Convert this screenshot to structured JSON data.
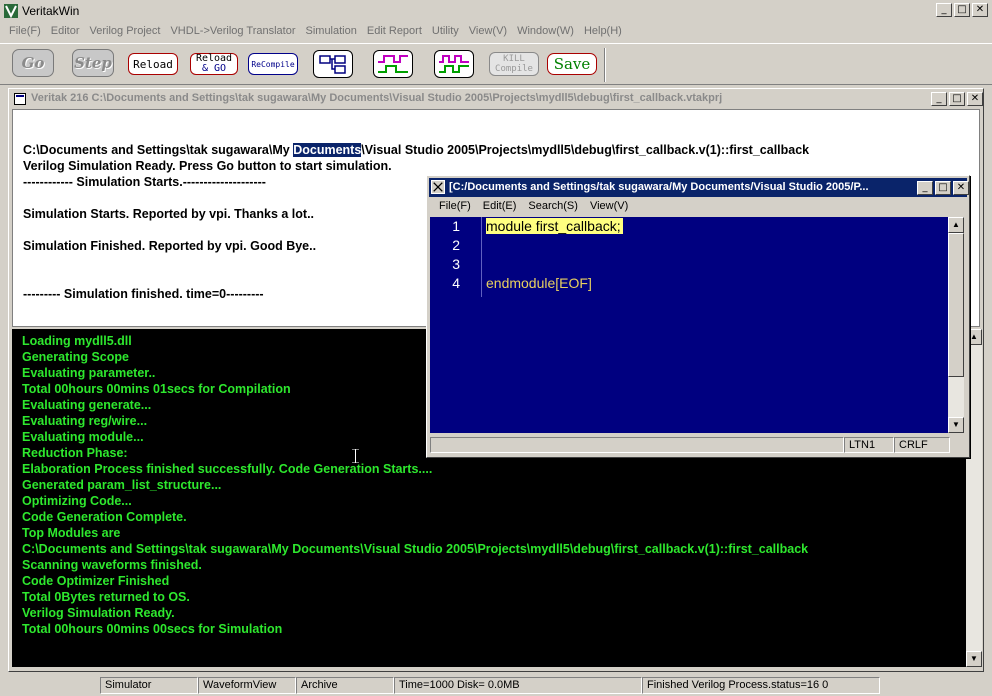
{
  "app": {
    "title": "VeritakWin",
    "window_buttons": {
      "minimize": "_",
      "maximize": "□",
      "close": "✕"
    }
  },
  "menubar": [
    "File(F)",
    "Editor",
    "Verilog Project",
    "VHDL->Verilog Translator",
    "Simulation",
    "Edit Report",
    "Utility",
    "View(V)",
    "Window(W)",
    "Help(H)"
  ],
  "toolbar": {
    "go": "Go",
    "step": "Step",
    "reload": "Reload",
    "reload_go_1": "Reload",
    "reload_go_2": "& GO",
    "recompile": "ReCompile",
    "kill_1": "KILL",
    "kill_2": "Compile",
    "save": "Save"
  },
  "project_window": {
    "title": "Veritak 216 C:\\Documents and Settings\\tak sugawara\\My Documents\\Visual Studio 2005\\Projects\\mydll5\\debug\\first_callback.vtakprj"
  },
  "log": {
    "path_pre": "C:\\Documents and Settings\\tak sugawara\\My ",
    "path_sel": "Documents",
    "path_post": "\\Visual Studio 2005\\Projects\\mydll5\\debug\\first_callback.v(1)::first_callback",
    "lines": [
      "Verilog Simulation Ready. Press Go button to start simulation.",
      "------------ Simulation Starts.--------------------",
      "Simulation Starts. Reported by vpi. Thanks a lot..",
      "Simulation Finished. Reported by vpi. Good Bye..",
      "--------- Simulation finished. time=0---------"
    ]
  },
  "console": [
    "Loading mydll5.dll",
    " Generating Scope",
    " Evaluating parameter..",
    "Total  00hours 00mins 01secs for Compilation",
    " Evaluating generate...",
    " Evaluating reg/wire...",
    " Evaluating module...",
    "Reduction Phase:",
    " Elaboration Process finished successfully. Code Generation Starts....",
    " Generated param_list_structure...",
    " Optimizing Code...",
    " Code Generation Complete.",
    "Top Modules are",
    "C:\\Documents and Settings\\tak sugawara\\My Documents\\Visual Studio 2005\\Projects\\mydll5\\debug\\first_callback.v(1)::first_callback",
    "Scanning waveforms finished.",
    "Code Optimizer Finished",
    "Total 0Bytes returned to OS.",
    "Verilog Simulation Ready.",
    "Total  00hours 00mins 00secs for Simulation"
  ],
  "editor": {
    "title": "[C:/Documents and Settings/tak sugawara/My Documents/Visual Studio 2005/P...",
    "menu": [
      "File(F)",
      "Edit(E)",
      "Search(S)",
      "View(V)"
    ],
    "lines": [
      {
        "n": "1",
        "text": "module first_callback;"
      },
      {
        "n": "2",
        "text": ""
      },
      {
        "n": "3",
        "text": ""
      },
      {
        "n": "4",
        "text": "endmodule[EOF]"
      }
    ],
    "status_line": "LTN1",
    "status_eol": "CRLF"
  },
  "statusbar": {
    "simulator": "Simulator",
    "waveform": "WaveformView",
    "archive": "Archive",
    "time_disk": "Time=1000 Disk=  0.0MB",
    "process": "Finished Verilog Process.status=16 0"
  },
  "colors": {
    "console_text": "#2ee82e",
    "editor_bg": "#000080",
    "editor_text": "#e8d060",
    "highlight": "#ffff80",
    "active_title": "#0a246a"
  }
}
